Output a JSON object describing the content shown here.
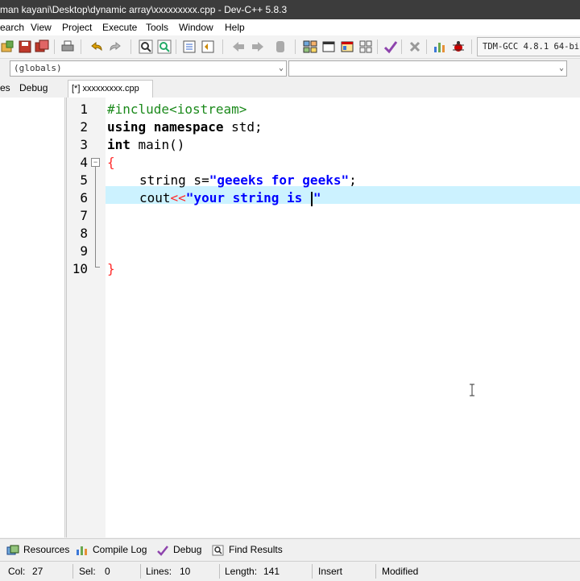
{
  "window": {
    "title": "man kayani\\Desktop\\dynamic array\\xxxxxxxxx.cpp - Dev-C++ 5.8.3"
  },
  "menu": {
    "items": [
      "earch",
      "View",
      "Project",
      "Execute",
      "Tools",
      "Window",
      "Help"
    ]
  },
  "toolbar": {
    "icons": [
      "open-project-icon",
      "save-icon",
      "save-all-icon",
      "print-icon",
      "undo-icon",
      "redo-icon",
      "find-icon",
      "replace-icon",
      "indent-icon",
      "unindent-icon",
      "back-icon",
      "forward-icon",
      "bookmark-icon",
      "new-class-icon",
      "new-window-icon",
      "layout-icon",
      "grid-icon",
      "check-icon",
      "stop-icon",
      "chart-icon",
      "debug-icon"
    ],
    "compiler": "TDM-GCC 4.8.1 64-bi"
  },
  "combos": {
    "scope": "(globals)",
    "members": ""
  },
  "left_tabs": {
    "classes": "es",
    "debug": "Debug"
  },
  "file_tab": {
    "label": "[*] xxxxxxxxx.cpp"
  },
  "editor": {
    "line_numbers": [
      "1",
      "2",
      "3",
      "4",
      "5",
      "6",
      "7",
      "8",
      "9",
      "10"
    ],
    "lines": {
      "l1": "#include<iostream>",
      "l2_kw": "using namespace",
      "l2_rest": " std;",
      "l3_kw": "int",
      "l3_rest": " main()",
      "l4": "{",
      "l5_type": "string",
      "l5_var": " s=",
      "l5_str": "\"geeeks for geeks\"",
      "l5_end": ";",
      "l6_id": "cout",
      "l6_op": "<<",
      "l6_str": "\"your string is ",
      "l6_str_end": "\"",
      "l10": "}"
    },
    "current_line": 6
  },
  "bottom_tabs": {
    "resources": "Resources",
    "compile_log": "Compile Log",
    "debug": "Debug",
    "find_results": "Find Results"
  },
  "status": {
    "col_label": "Col:",
    "col": "27",
    "sel_label": "Sel:",
    "sel": "0",
    "lines_label": "Lines:",
    "lines": "10",
    "length_label": "Length:",
    "length": "141",
    "mode": "Insert",
    "modified": "Modified"
  },
  "colors": {
    "current_line": "#ccf2ff",
    "preprocessor": "#1c8a1c",
    "string": "#0000ff",
    "operator": "#ff2a2a"
  }
}
